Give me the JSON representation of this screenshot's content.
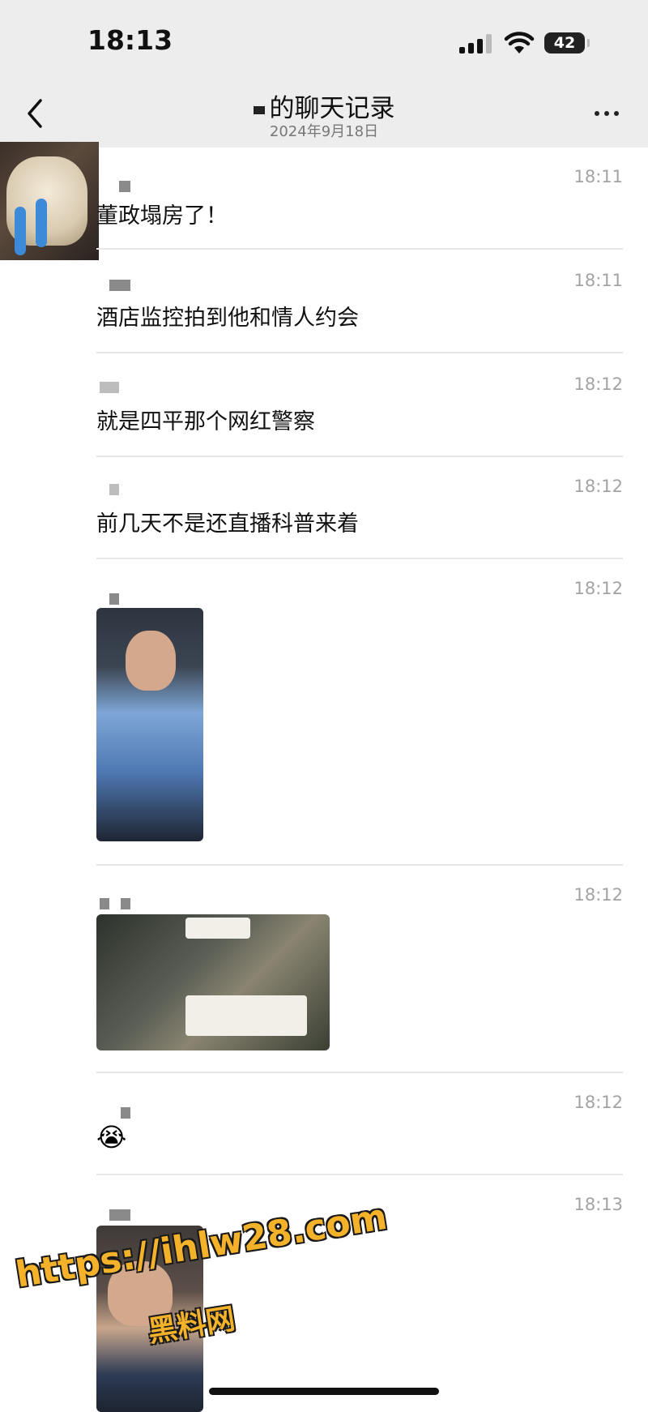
{
  "status": {
    "time": "18:13",
    "battery": "42"
  },
  "nav": {
    "title": "的聊天记录",
    "subtitle": "2024年9月18日"
  },
  "messages": [
    {
      "time": "18:11",
      "text": "董政塌房了！"
    },
    {
      "time": "18:11",
      "text": "酒店监控拍到他和情人约会"
    },
    {
      "time": "18:12",
      "text": "就是四平那个网红警察"
    },
    {
      "time": "18:12",
      "text": "前几天不是还直播科普来着"
    },
    {
      "time": "18:12",
      "type": "image"
    },
    {
      "time": "18:12",
      "type": "image"
    },
    {
      "time": "18:12",
      "emoji": "😭"
    },
    {
      "time": "18:13",
      "type": "image"
    }
  ],
  "watermark": {
    "url": "https://ihlw28.com",
    "name": "黑料网"
  },
  "colors": {
    "bar_bg": "#ededed",
    "divider": "#e7e7e7",
    "time_text": "#a3a3a3",
    "watermark": "#f4b12a"
  }
}
